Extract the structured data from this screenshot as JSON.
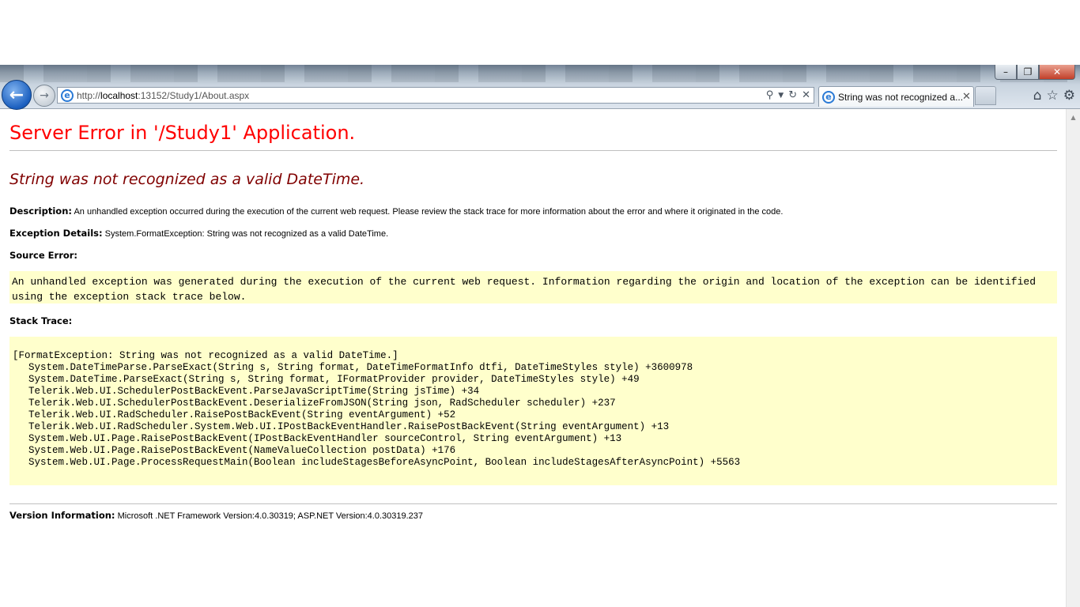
{
  "browser": {
    "address_url_prefix": "http://",
    "address_url_host": "localhost",
    "address_url_rest": ":13152/Study1/About.aspx",
    "tab_title": "String was not recognized a...",
    "window_controls": [
      "minimize",
      "restore",
      "close"
    ],
    "toolbar_icons": [
      "home-icon",
      "star-icon",
      "gear-icon"
    ]
  },
  "error_page": {
    "heading": "Server Error in '/Study1' Application.",
    "subheading": "String was not recognized as a valid DateTime.",
    "description_label": "Description:",
    "description_text": "An unhandled exception occurred during the execution of the current web request. Please review the stack trace for more information about the error and where it originated in the code.",
    "exception_label": "Exception Details:",
    "exception_text": "System.FormatException: String was not recognized as a valid DateTime.",
    "source_error_label": "Source Error:",
    "source_error_text": "An unhandled exception was generated during the execution of the current web request. Information regarding the origin and location of the exception can be identified using the exception stack trace below.",
    "stack_trace_label": "Stack Trace:",
    "stack_trace": [
      "[FormatException: String was not recognized as a valid DateTime.]",
      "System.DateTimeParse.ParseExact(String s, String format, DateTimeFormatInfo dtfi, DateTimeStyles style) +3600978",
      "System.DateTime.ParseExact(String s, String format, IFormatProvider provider, DateTimeStyles style) +49",
      "Telerik.Web.UI.SchedulerPostBackEvent.ParseJavaScriptTime(String jsTime) +34",
      "Telerik.Web.UI.SchedulerPostBackEvent.DeserializeFromJSON(String json, RadScheduler scheduler) +237",
      "Telerik.Web.UI.RadScheduler.RaisePostBackEvent(String eventArgument) +52",
      "Telerik.Web.UI.RadScheduler.System.Web.UI.IPostBackEventHandler.RaisePostBackEvent(String eventArgument) +13",
      "System.Web.UI.Page.RaisePostBackEvent(IPostBackEventHandler sourceControl, String eventArgument) +13",
      "System.Web.UI.Page.RaisePostBackEvent(NameValueCollection postData) +176",
      "System.Web.UI.Page.ProcessRequestMain(Boolean includeStagesBeforeAsyncPoint, Boolean includeStagesAfterAsyncPoint) +5563"
    ],
    "version_label": "Version Information:",
    "version_text": "Microsoft .NET Framework Version:4.0.30319; ASP.NET Version:4.0.30319.237"
  },
  "colors": {
    "heading": "#ff0000",
    "subheading": "#800000",
    "code_background": "#ffffcc"
  }
}
